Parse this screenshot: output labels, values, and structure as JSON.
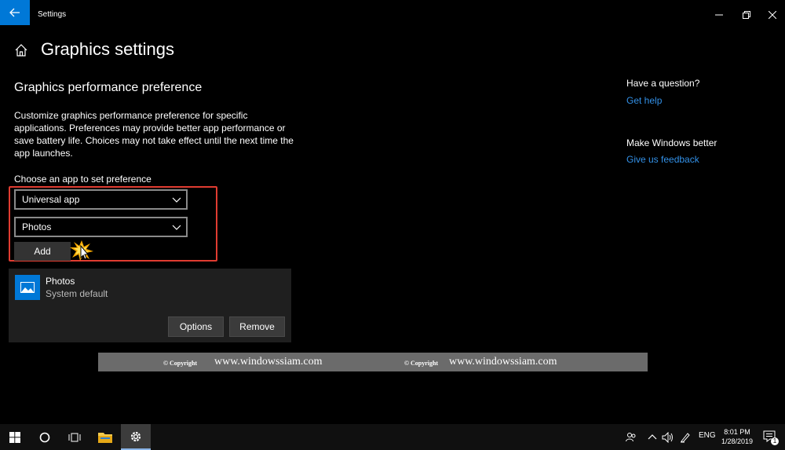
{
  "window": {
    "title": "Settings",
    "accent": "#0078d7"
  },
  "header": {
    "page_title": "Graphics settings"
  },
  "main": {
    "section_title": "Graphics performance preference",
    "description": "Customize graphics performance preference for specific applications. Preferences may provide better app performance or save battery life. Choices may not take effect until the next time the app launches.",
    "choose_label": "Choose an app to set preference",
    "app_type_dropdown": "Universal app",
    "app_dropdown": "Photos",
    "add_label": "Add",
    "app_card": {
      "name": "Photos",
      "preference": "System default",
      "options_label": "Options",
      "remove_label": "Remove"
    }
  },
  "watermark": {
    "copyright_1": "© Copyright",
    "site_1": "www.windowssiam.com",
    "copyright_2": "© Copyright",
    "site_2": "www.windowssiam.com"
  },
  "sidebar": {
    "question": "Have a question?",
    "help_link": "Get help",
    "improve": "Make Windows better",
    "feedback_link": "Give us feedback",
    "link_color": "#3391e8"
  },
  "taskbar": {
    "language": "ENG",
    "time": "8:01 PM",
    "date": "1/28/2019",
    "notification_count": "1"
  }
}
